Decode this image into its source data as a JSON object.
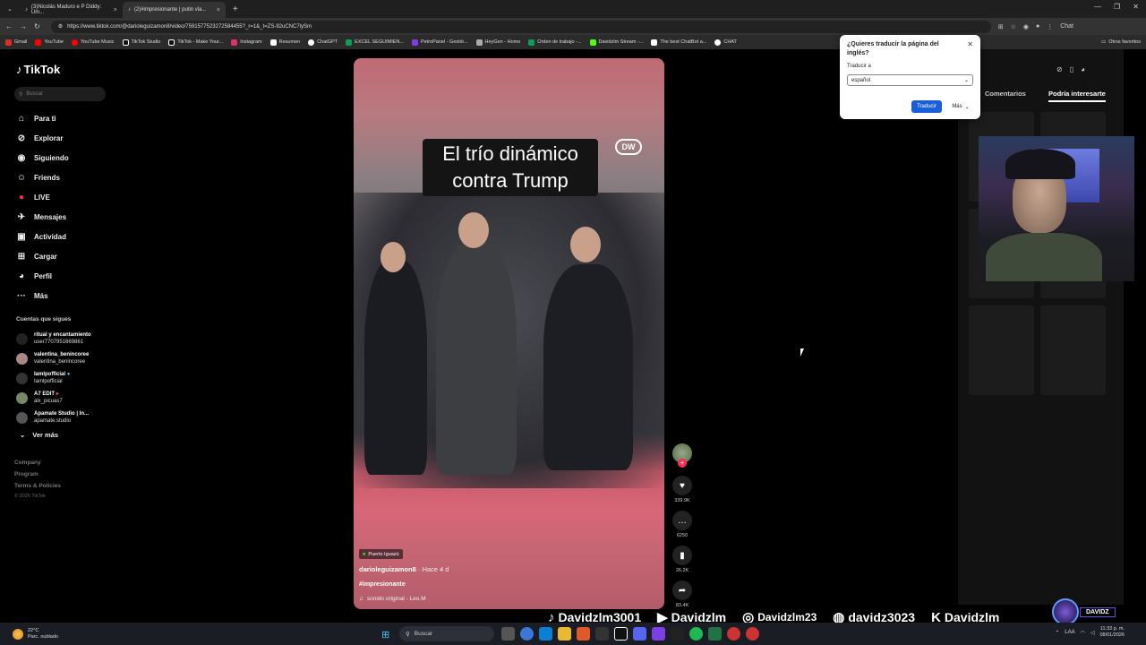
{
  "browser": {
    "tabs": [
      {
        "title": "(3)Nicolás Maduro e P Diddy: Um...",
        "active": false
      },
      {
        "title": "(2)#impresionante | putin vla...",
        "active": true
      }
    ],
    "url": "https://www.tiktok.com/@darioleguizamon8/video/7591577523272584455?_r=1&_t=ZS-92uCNC7lySm",
    "bookmarks": [
      "Gmail",
      "YouTube",
      "YouTube Music",
      "TikTok Studio",
      "TikTok - Make Your...",
      "Instagram",
      "Resumen",
      "ChatGPT",
      "EXCEL SEGUIMIEN...",
      "PetroPanel - Gestió...",
      "HeyGen - Home",
      "Orden de trabajo -...",
      "Davidzlm Stream -...",
      "The best ChatBot a...",
      "CHAT"
    ],
    "bookmarks_other": "Otros favoritos",
    "chat_label": "Chat"
  },
  "tiktok": {
    "logo": "TikTok",
    "search_placeholder": "Buscar",
    "nav": [
      "Para ti",
      "Explorar",
      "Siguiendo",
      "Friends",
      "LIVE",
      "Mensajes",
      "Actividad",
      "Cargar",
      "Perfil",
      "Más"
    ],
    "following_title": "Cuentas que sigues",
    "following": [
      {
        "name": "ritual y encantamiento",
        "handle": "user7707951669861"
      },
      {
        "name": "valentina_benincoree",
        "handle": "valentina_benincoree"
      },
      {
        "name": "Iamlpofficial",
        "handle": "Iamlpofficial"
      },
      {
        "name": "A7 EDIT",
        "handle": "alx_picuas7"
      },
      {
        "name": "Apamate Studio | In...",
        "handle": "apamate.studio"
      }
    ],
    "see_more": "Ver más",
    "footer": [
      "Company",
      "Program",
      "Terms & Policies"
    ],
    "copyright": "© 2026 TikTok"
  },
  "video": {
    "caption_line1": "El trío dinámico",
    "caption_line2": "contra Trump",
    "watermark": "DW",
    "location": "Puerto Iguazú",
    "author": "darioleguizamon8",
    "posted": "· Hace 4 d",
    "hashtag": "#impresionante",
    "sound": "sonido original - Leo.M",
    "likes": "339.9K",
    "comments": "6250",
    "saves": "26.2K",
    "shares": "83.4K"
  },
  "right_panel": {
    "tabs": [
      "Comentarios",
      "Podría interesarte"
    ]
  },
  "translate_popup": {
    "question": "¿Quieres traducir la página del inglés?",
    "label": "Traducir a",
    "selected": "español",
    "translate_btn": "Traducir",
    "more_btn": "Más"
  },
  "overlay": {
    "socials": [
      {
        "icon": "tiktok-icon",
        "handle": "Davidzlm3001"
      },
      {
        "icon": "youtube-icon",
        "handle": "Davidzlm"
      },
      {
        "icon": "instagram-icon",
        "handle": "Davidzlm23"
      },
      {
        "icon": "discord-icon",
        "handle": "davidz3023"
      },
      {
        "icon": "kick-icon",
        "handle": "Davidzlm"
      }
    ],
    "brand": "DAVIDZ"
  },
  "taskbar": {
    "temp": "22°C",
    "weather": "Parc. nublado",
    "search": "Buscar",
    "time": "11:33 p. m.",
    "date": "08/01/2026",
    "lang": "LAA"
  }
}
